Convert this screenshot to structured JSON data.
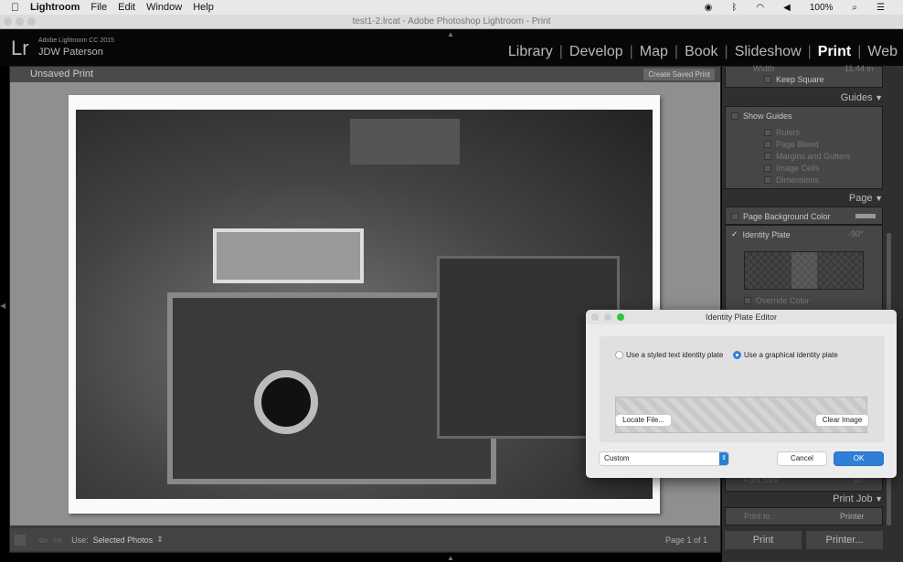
{
  "menubar": {
    "apple": "",
    "app": "Lightroom",
    "items": [
      "File",
      "Edit",
      "Window",
      "Help"
    ],
    "battery": "100%"
  },
  "window_title": "test1-2.lrcat - Adobe Photoshop Lightroom - Print",
  "identity": {
    "logo": "Lr",
    "product": "Adobe Lightroom CC 2015",
    "user": "JDW Paterson"
  },
  "modules": [
    "Library",
    "Develop",
    "Map",
    "Book",
    "Slideshow",
    "Print",
    "Web"
  ],
  "active_module": "Print",
  "print_header": {
    "title": "Unsaved Print",
    "create_button": "Create Saved Print"
  },
  "right_panel": {
    "width_label": "Width",
    "width_value": "11.44 in",
    "keep_square": "Keep Square",
    "guides": {
      "title": "Guides",
      "show": "Show Guides",
      "items": [
        "Rulers",
        "Page Bleed",
        "Margins and Gutters",
        "Image Cells",
        "Dimensions"
      ]
    },
    "page": {
      "title": "Page",
      "bg_color": "Page Background Color",
      "identity_plate": "Identity Plate",
      "rotation": "-90°",
      "override": "Override Color",
      "font_size_label": "Font Size :",
      "font_size": "10"
    },
    "print_job": {
      "title": "Print Job",
      "print_to_label": "Print to :",
      "print_to": "Printer"
    },
    "print_button": "Print",
    "printer_button": "Printer..."
  },
  "toolbar": {
    "use_label": "Use:",
    "use_value": "Selected Photos",
    "page": "Page 1 of 1"
  },
  "dialog": {
    "title": "Identity Plate Editor",
    "radio_text": "Use a styled text identity plate",
    "radio_graphic": "Use a graphical identity plate",
    "selected": "graphic",
    "locate": "Locate File...",
    "clear": "Clear Image",
    "preset": "Custom",
    "cancel": "Cancel",
    "ok": "OK"
  },
  "colors": {
    "accent": "#2a7fd4",
    "panel": "#464646",
    "canvas": "#8f8f8f"
  }
}
